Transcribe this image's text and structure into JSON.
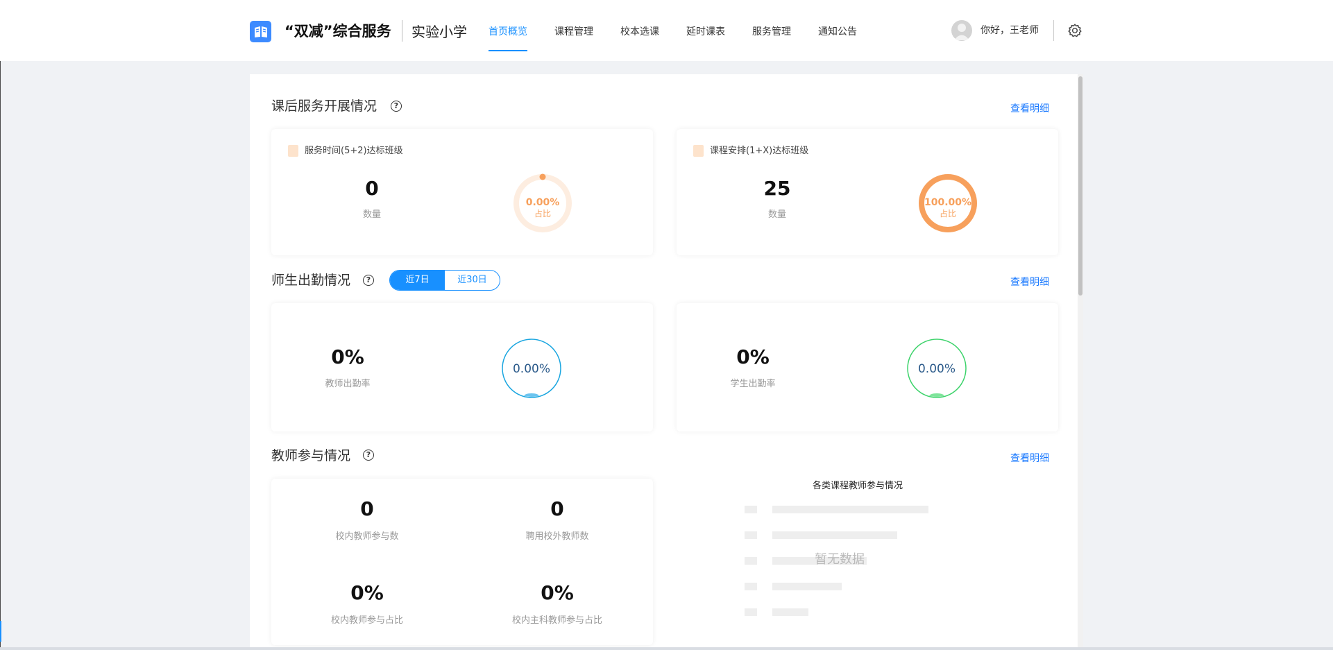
{
  "header": {
    "brand": "“双减”综合服务",
    "school": "实验小学",
    "nav": [
      {
        "label": "首页概览",
        "active": true
      },
      {
        "label": "课程管理"
      },
      {
        "label": "校本选课"
      },
      {
        "label": "延时课表"
      },
      {
        "label": "服务管理"
      },
      {
        "label": "通知公告"
      }
    ],
    "greeting": "你好，王老师"
  },
  "service": {
    "title": "课后服务开展情况",
    "detail_link": "查看明细",
    "cards": [
      {
        "label": "服务时间(5+2)达标班级",
        "count": "0",
        "count_label": "数量",
        "percent_text": "0.00%",
        "percent": 0.0,
        "percent_label": "占比",
        "color": "#f7a05c"
      },
      {
        "label": "课程安排(1+X)达标班级",
        "count": "25",
        "count_label": "数量",
        "percent_text": "100.00%",
        "percent": 1.0,
        "percent_label": "占比",
        "color": "#f7a05c"
      }
    ]
  },
  "attendance": {
    "title": "师生出勤情况",
    "detail_link": "查看明细",
    "tabs": [
      "近7日",
      "近30日"
    ],
    "active_tab": 0,
    "cards": [
      {
        "value": "0%",
        "label": "教师出勤率",
        "gauge_text": "0.00%",
        "level": 0.0,
        "color": "#1aa6e0",
        "fill": "#6cc4ef"
      },
      {
        "value": "0%",
        "label": "学生出勤率",
        "gauge_text": "0.00%",
        "level": 0.0,
        "color": "#3dd36b",
        "fill": "#7fe49b"
      }
    ]
  },
  "teachers": {
    "title": "教师参与情况",
    "detail_link": "查看明细",
    "stats": [
      {
        "value": "0",
        "label": "校内教师参与数"
      },
      {
        "value": "0",
        "label": "聘用校外教师数"
      },
      {
        "value": "0%",
        "label": "校内教师参与占比"
      },
      {
        "value": "0%",
        "label": "校内主科教师参与占比"
      }
    ],
    "chart_title": "各类课程教师参与情况",
    "no_data": "暂无数据"
  }
}
